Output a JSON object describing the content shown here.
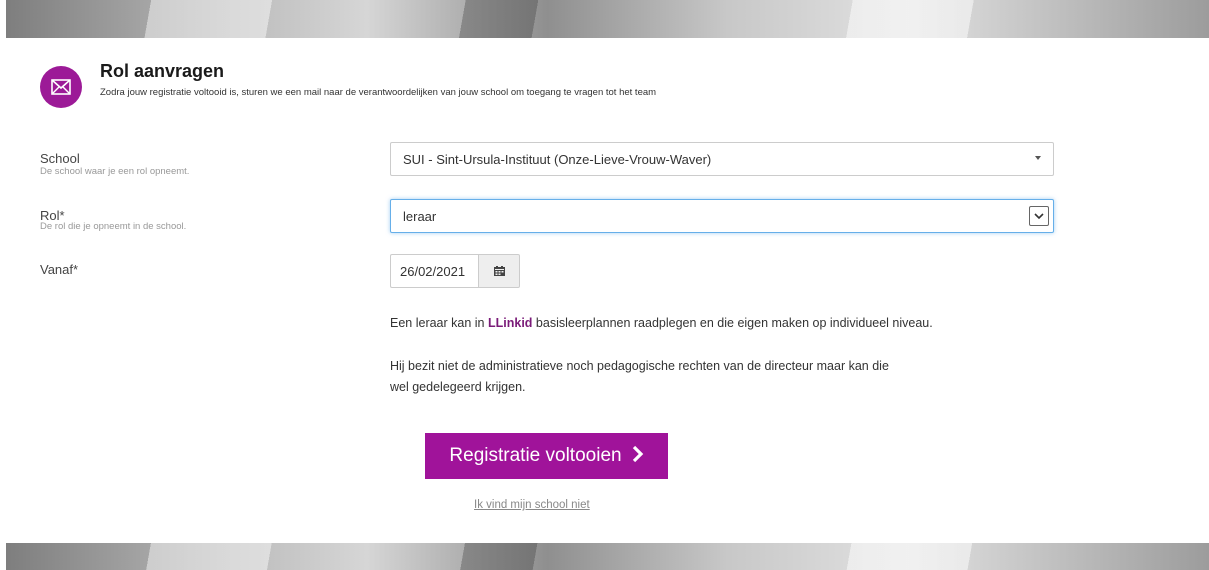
{
  "header": {
    "title": "Rol aanvragen",
    "subtitle": "Zodra jouw registratie voltooid is, sturen we een mail naar de verantwoordelijken van jouw school om toegang te vragen tot het team",
    "icon": "envelope-icon",
    "accent_color": "#9c1a97"
  },
  "form": {
    "school": {
      "label": "School",
      "hint": "De school waar je een rol opneemt.",
      "value": "SUI - Sint-Ursula-Instituut (Onze-Lieve-Vrouw-Waver)"
    },
    "rol": {
      "label": "Rol*",
      "hint": "De rol die je opneemt in de school.",
      "value": "leraar"
    },
    "vanaf": {
      "label": "Vanaf*",
      "value": "26/02/2021",
      "icon": "calendar-icon"
    }
  },
  "info": {
    "line1_before": "Een leraar kan in ",
    "line1_link": "LLinkid",
    "line1_after": " basisleerplannen raadplegen en die eigen maken op individueel niveau.",
    "line2": "Hij bezit niet de administratieve noch pedagogische rechten van de directeur maar kan die wel gedelegeerd krijgen."
  },
  "actions": {
    "submit_label": "Registratie voltooien",
    "submit_color": "#a0139a",
    "not_found_link": "Ik vind mijn school niet"
  }
}
